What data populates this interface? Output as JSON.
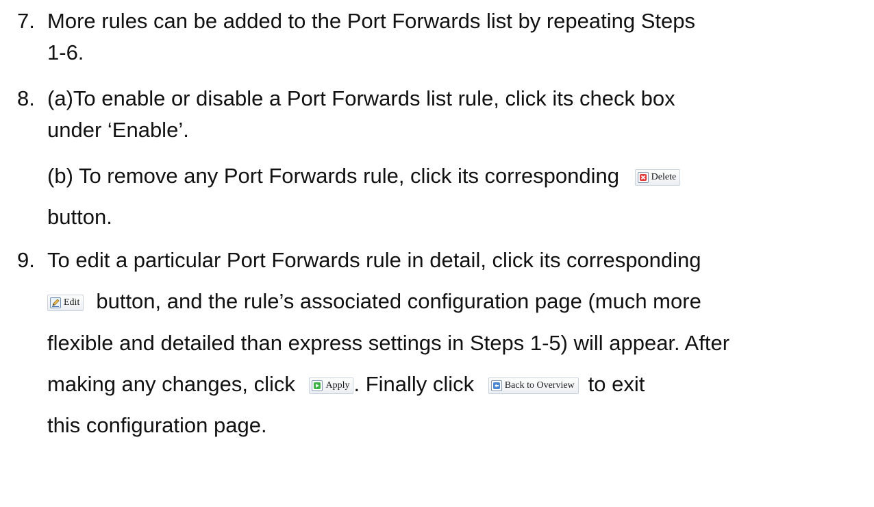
{
  "items": {
    "n7": "7.",
    "l7a": "More rules can be added to the Port Forwards list by repeating Steps",
    "l7b": "1-6.",
    "n8": "8.",
    "l8a": "(a)To enable or disable a Port Forwards list rule, click its check box",
    "l8b": "under ‘Enable’.",
    "l8c": "(b) To remove any Port Forwards rule, click its corresponding",
    "l8d": "button.",
    "n9": "9.",
    "l9a": "To edit a particular Port Forwards rule in detail, click its corresponding",
    "l9b": "button, and the rule’s associated configuration page (much more",
    "l9c": "flexible and detailed than express settings in Steps 1-5) will appear. After",
    "l9d1": "making any changes, click",
    "l9d2": ". Finally click",
    "l9d3": "to exit",
    "l9e": "this configuration page."
  },
  "buttons": {
    "delete": "Delete",
    "edit": "Edit",
    "apply": "Apply",
    "back": "Back to Overview"
  },
  "icons": {
    "delete": "delete-x-icon",
    "edit": "edit-pencil-icon",
    "apply": "apply-play-icon",
    "back": "back-arrow-icon"
  }
}
